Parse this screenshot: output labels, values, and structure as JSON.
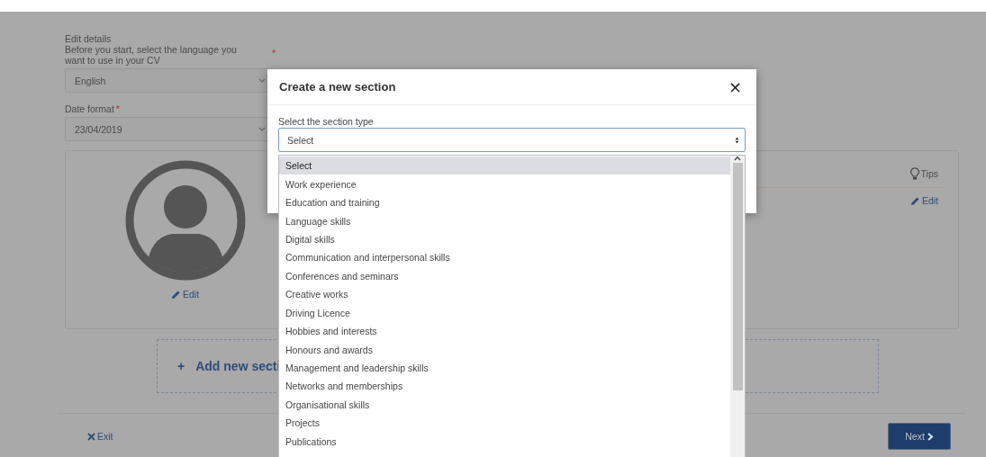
{
  "edit_details": {
    "heading": "Edit details",
    "instruction": "Before you start, select the language you want to use in your CV",
    "required_mark": "*"
  },
  "language_select": {
    "value": "English"
  },
  "date_format": {
    "label": "Date format",
    "required_mark": "*",
    "value": "23/04/2019"
  },
  "profile_card": {
    "photo_edit": "Edit",
    "tips": "Tips",
    "edit": "Edit"
  },
  "add_section": {
    "icon": "+",
    "label": "Add new secti"
  },
  "footer": {
    "exit": "Exit",
    "next": "Next"
  },
  "dialog": {
    "title": "Create a new section",
    "close": "×",
    "field_label": "Select the section type",
    "select_value": "Select",
    "options": [
      {
        "label": "Select",
        "selected": true
      },
      {
        "label": "Work experience",
        "selected": false
      },
      {
        "label": "Education and training",
        "selected": false
      },
      {
        "label": "Language skills",
        "selected": false
      },
      {
        "label": "Digital skills",
        "selected": false
      },
      {
        "label": "Communication and interpersonal skills",
        "selected": false
      },
      {
        "label": "Conferences and seminars",
        "selected": false
      },
      {
        "label": "Creative works",
        "selected": false
      },
      {
        "label": "Driving Licence",
        "selected": false
      },
      {
        "label": "Hobbies and interests",
        "selected": false
      },
      {
        "label": "Honours and awards",
        "selected": false
      },
      {
        "label": "Management and leadership skills",
        "selected": false
      },
      {
        "label": "Networks and memberships",
        "selected": false
      },
      {
        "label": "Organisational skills",
        "selected": false
      },
      {
        "label": "Projects",
        "selected": false
      },
      {
        "label": "Publications",
        "selected": false
      }
    ]
  }
}
